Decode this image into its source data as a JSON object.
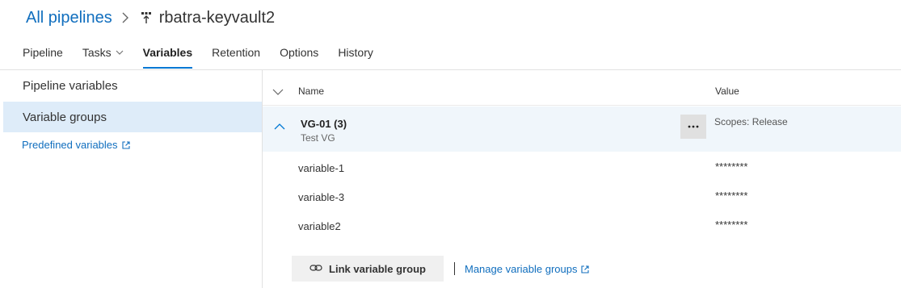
{
  "breadcrumb": {
    "root": "All pipelines",
    "title": "rbatra-keyvault2"
  },
  "tabs": [
    {
      "label": "Pipeline"
    },
    {
      "label": "Tasks"
    },
    {
      "label": "Variables"
    },
    {
      "label": "Retention"
    },
    {
      "label": "Options"
    },
    {
      "label": "History"
    }
  ],
  "selected_tab": "Variables",
  "left_nav": {
    "pipeline_variables": "Pipeline variables",
    "variable_groups": "Variable groups",
    "predefined_variables": "Predefined variables"
  },
  "table": {
    "col_name": "Name",
    "col_value": "Value",
    "group": {
      "name": "VG-01 (3)",
      "description": "Test VG",
      "more_label": "...",
      "scope": "Scopes: Release"
    },
    "variables": [
      {
        "name": "variable-1",
        "value": "********"
      },
      {
        "name": "variable-3",
        "value": "********"
      },
      {
        "name": "variable2",
        "value": "********"
      }
    ]
  },
  "actions": {
    "link_variable_group": "Link variable group",
    "separator": "|",
    "manage_variable_groups": "Manage variable groups"
  },
  "colors": {
    "accent": "#0078d4",
    "link": "#106ebe",
    "selected_bg": "#deecf9"
  }
}
